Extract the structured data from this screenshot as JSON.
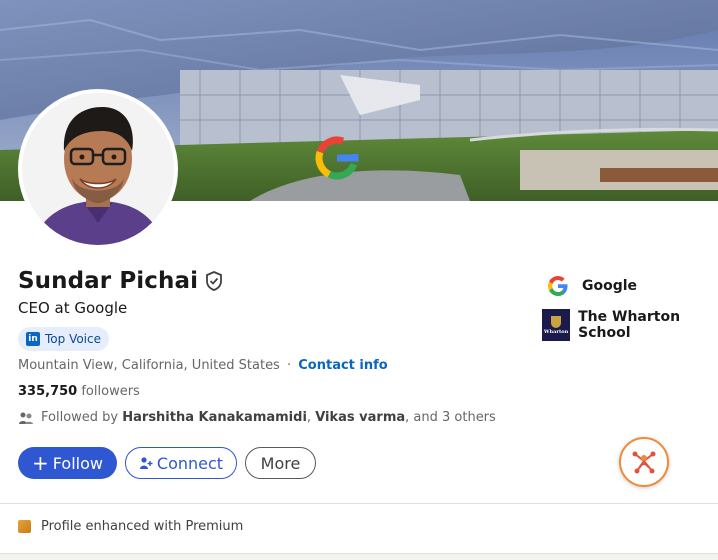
{
  "profile": {
    "name": "Sundar Pichai",
    "headline": "CEO at Google",
    "badge_label": "Top Voice",
    "badge_icon": "linkedin-icon",
    "location": "Mountain View, California, United States",
    "separator": "·",
    "contact_link": "Contact info",
    "followers_count": "335,750",
    "followers_label": "followers",
    "followed_by_prefix": "Followed by",
    "mutual_1": "Harshitha Kanakamamidi",
    "mutual_sep": ",",
    "mutual_2": "Vikas varma",
    "followed_by_suffix": ", and 3 others"
  },
  "actions": {
    "follow_label": "Follow",
    "connect_label": "Connect",
    "more_label": "More"
  },
  "companies": [
    {
      "name": "Google",
      "icon": "google-logo-icon"
    },
    {
      "name": "The Wharton School",
      "icon": "wharton-logo-icon"
    }
  ],
  "wharton_logo_text": "Wharton",
  "premium": {
    "label": "Profile enhanced with Premium",
    "icon": "premium-icon"
  },
  "colors": {
    "primary_blue": "#2f57d2",
    "link_blue": "#0a66c2",
    "fab_orange": "#f08a3a",
    "badge_bg": "#e6eefc"
  }
}
